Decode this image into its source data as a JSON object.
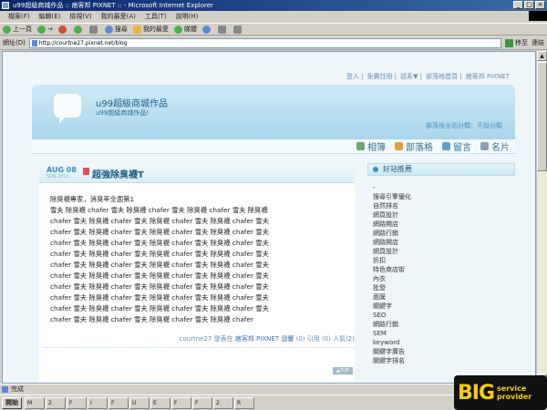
{
  "window": {
    "title": "u99超級商城作品 :: 痞客邦 PIXNET :: - Microsoft Internet Explorer",
    "controls": [
      "_",
      "□",
      "×"
    ]
  },
  "menubar": {
    "items": [
      "檔案(F)",
      "編輯(E)",
      "檢視(V)",
      "我的最愛(A)",
      "工具(T)",
      "說明(H)"
    ]
  },
  "toolbar": {
    "back": "上一頁",
    "forward": "→",
    "search": "搜尋",
    "favorites": "我的最愛",
    "media": "媒體"
  },
  "addressbar": {
    "label": "網址(D)",
    "url": "http://courtne27.pixnet.net/blog",
    "go": "移至",
    "links": "連結"
  },
  "blog": {
    "top_links": [
      "登入",
      "免費註冊",
      "話系▼",
      "部落格首頁",
      "痞客邦 PIXNET"
    ],
    "title": "u99超級商城作品",
    "subtitle": "u99超級商城作品!",
    "partner_info": "部落格全站分類：不設分類",
    "nav": [
      "相簿",
      "部落格",
      "留言",
      "名片"
    ]
  },
  "post": {
    "date_month": "AUG 08",
    "date_sub": "SUN 2010",
    "title": "超強除臭襪T",
    "lines": [
      "除臭襪專家，消臭率全面第1",
      "雪夫  除臭襪  chafer  雪夫  除臭襪  chafer  雪夫  除臭襪  chafer  雪夫  除臭襪",
      "chafer  雪夫  除臭襪  chafer  雪夫  除臭襪  chafer  雪夫  除臭襪  chafer  雪夫",
      "chafer  雪夫  除臭襪  chafer  雪夫  除臭襪  chafer  雪夫  除臭襪  chafer  雪夫",
      "chafer  雪夫  除臭襪  chafer  雪夫  除臭襪  chafer  雪夫  除臭襪  chafer  雪夫",
      "chafer  雪夫  除臭襪  chafer  雪夫  除臭襪  chafer  雪夫  除臭襪  chafer  雪夫",
      "chafer  雪夫  除臭襪  chafer  雪夫  除臭襪  chafer  雪夫  除臭襪  chafer  雪夫",
      "chafer  雪夫  除臭襪  chafer  雪夫  除臭襪  chafer  雪夫  除臭襪  chafer  雪夫",
      "chafer  雪夫  除臭襪  chafer  雪夫  除臭襪  chafer  雪夫  除臭襪  chafer  雪夫",
      "chafer  雪夫  除臭襪  chafer  雪夫  除臭襪  chafer  雪夫  除臭襪  chafer  雪夫",
      "chafer  雪夫  除臭襪  chafer  雪夫  除臭襪  chafer  雪夫  除臭襪  chafer  雪夫",
      "chafer  雪夫  除臭襪  chafer  雪夫  除臭襪  chafer  雪夫  除臭襪  chafer"
    ],
    "meta_author": "courtne27 發表在",
    "meta_site": "痞客邦 PIXNET",
    "meta_reply": "迴響",
    "meta_ref": "(0) 引用",
    "meta_views": "(0) 人氣(2)",
    "top_label": "▲TOP"
  },
  "sidebar": {
    "heading": "好站推薦",
    "items": [
      "-",
      "搜尋引擎優化",
      "自然排名",
      "網頁設計",
      "網路開店",
      "網路行銷",
      "網路開店",
      "網頁設計",
      "折扣",
      "特色商店街",
      "內衣",
      "批發",
      "面膜",
      "關鍵字",
      "SEO",
      "網路行銷",
      "SEM",
      "keyword",
      "關鍵字廣告",
      "關鍵字排名"
    ]
  },
  "status": {
    "text": "完成"
  },
  "taskbar": {
    "start": "開始",
    "tasks": [
      "M",
      "2",
      "F",
      "I",
      "F",
      "U",
      "E",
      "F",
      "F",
      "2",
      "R"
    ]
  },
  "watermark": {
    "big": "BIG",
    "small1": "service",
    "small2": "provider"
  }
}
